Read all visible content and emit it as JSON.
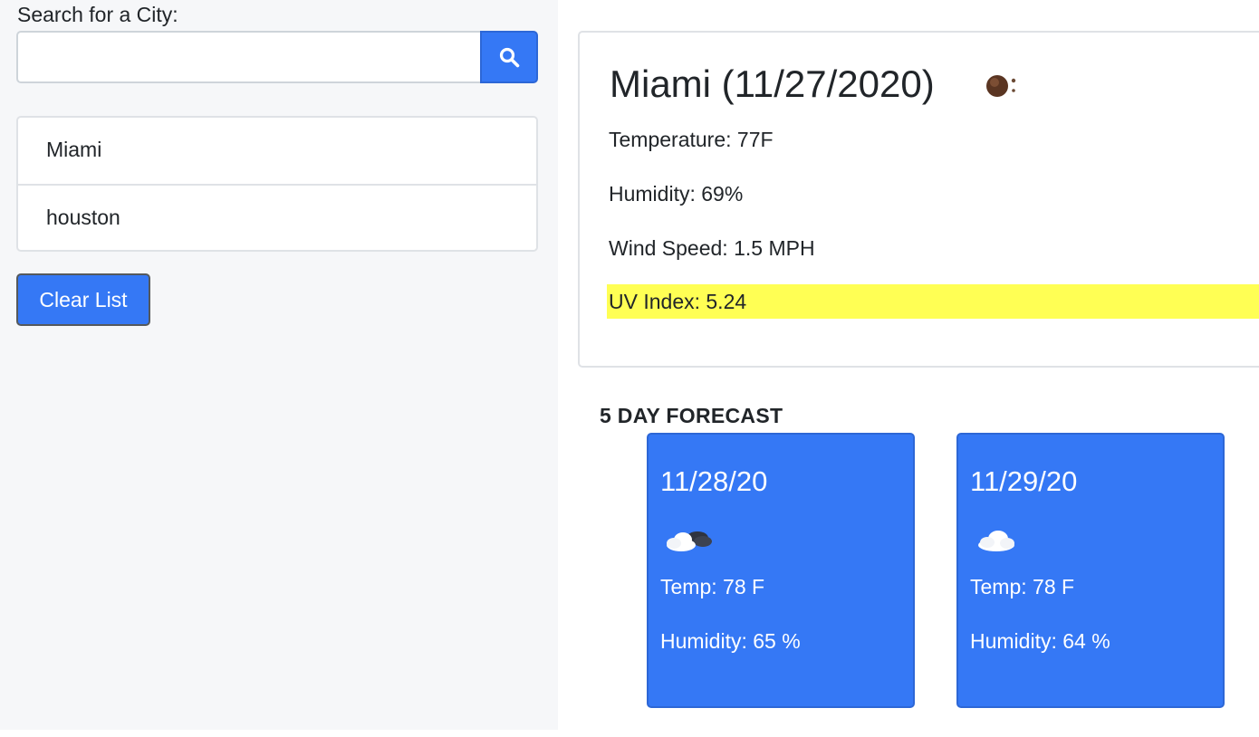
{
  "search": {
    "label": "Search for a City:",
    "value": "",
    "placeholder": "",
    "button_icon": "search-icon"
  },
  "history": {
    "items": [
      {
        "label": "Miami"
      },
      {
        "label": "houston"
      }
    ],
    "clear_label": "Clear List"
  },
  "current": {
    "title": "Miami (11/27/2020)",
    "icon": "moon-icon",
    "temperature": "Temperature: 77F",
    "humidity": "Humidity: 69%",
    "wind": "Wind Speed: 1.5 MPH",
    "uv": "UV Index: 5.24",
    "uv_color": "#ffff54"
  },
  "forecast": {
    "heading": "5 DAY FORECAST",
    "days": [
      {
        "date": "11/28/20",
        "icon": "cloud-moon-icon",
        "temp": "Temp: 78 F",
        "humidity": "Humidity: 65 %"
      },
      {
        "date": "11/29/20",
        "icon": "cloud-icon",
        "temp": "Temp: 78 F",
        "humidity": "Humidity: 64 %"
      }
    ]
  },
  "colors": {
    "accent": "#3578f5",
    "sidebar_bg": "#f6f7f9",
    "uv_highlight": "#ffff54"
  }
}
